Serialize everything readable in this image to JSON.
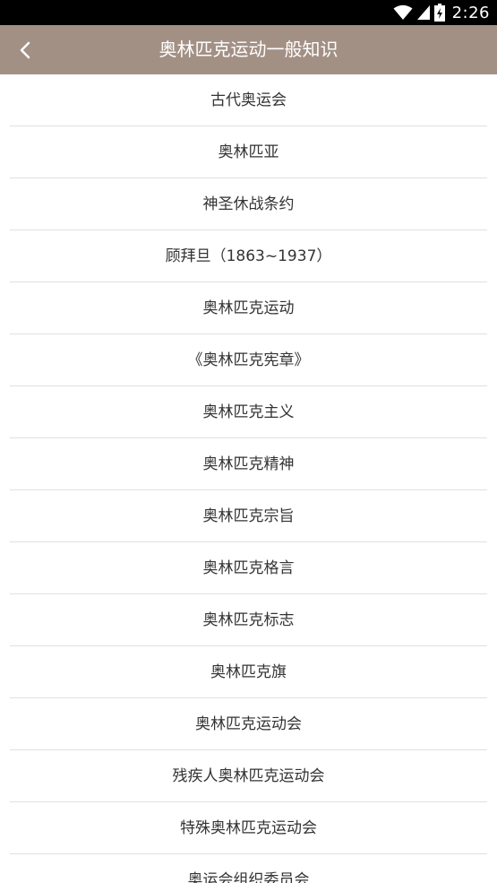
{
  "status_bar": {
    "time": "2:26",
    "icons": [
      "wifi-icon",
      "signal-icon",
      "battery-charging-icon"
    ],
    "background": "#000000"
  },
  "app_bar": {
    "title": "奥林匹克运动一般知识",
    "back_icon": "chevron-left-icon",
    "background": "#a39085"
  },
  "topics": [
    "古代奥运会",
    "奥林匹亚",
    "神圣休战条约",
    "顾拜旦（1863~1937）",
    "奥林匹克运动",
    "《奥林匹克宪章》",
    "奥林匹克主义",
    "奥林匹克精神",
    "奥林匹克宗旨",
    "奥林匹克格言",
    "奥林匹克标志",
    "奥林匹克旗",
    "奥林匹克运动会",
    "残疾人奥林匹克运动会",
    "特殊奥林匹克运动会",
    "奥运会组织委员会"
  ]
}
